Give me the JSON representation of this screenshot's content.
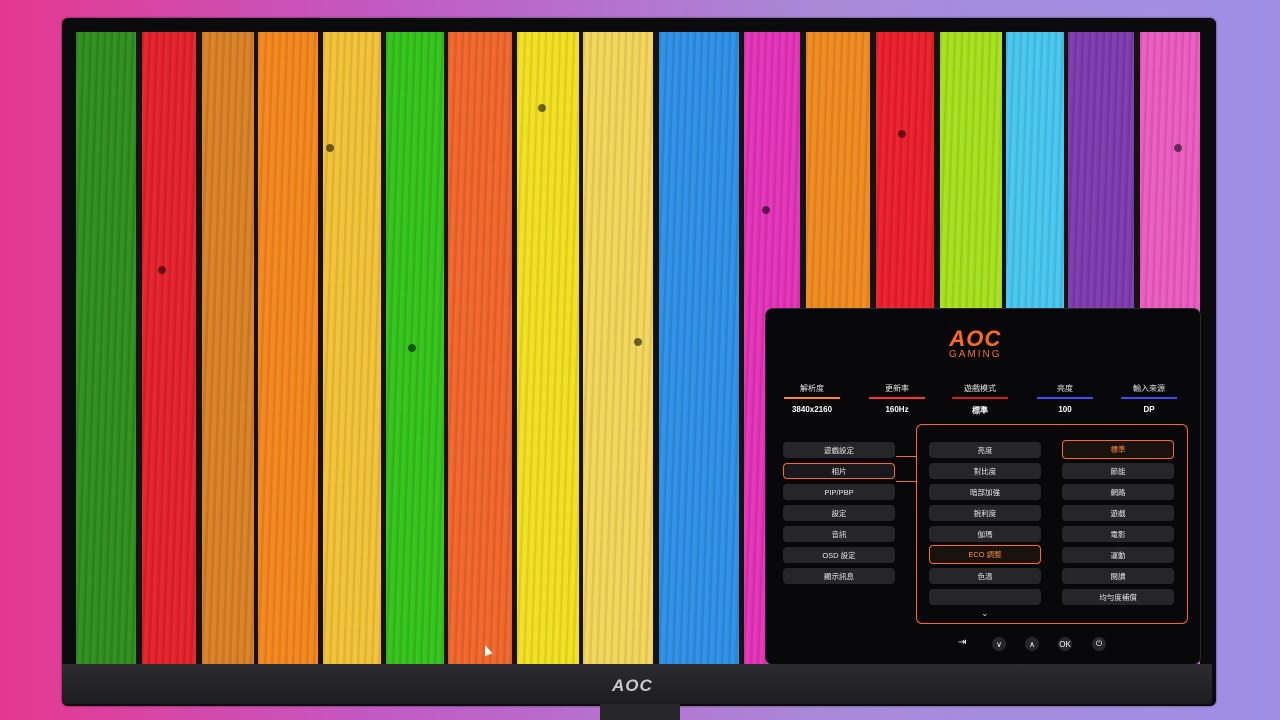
{
  "bezel": {
    "brand": "AOC"
  },
  "osd": {
    "logo": {
      "line1": "AOC",
      "line2": "GAMING"
    },
    "stats": [
      {
        "label": "解析度",
        "value": "3840x2160",
        "color": "#ff8a1a"
      },
      {
        "label": "更新率",
        "value": "160Hz",
        "color": "#ff3030"
      },
      {
        "label": "遊戲模式",
        "value": "標準",
        "color": "#d02020"
      },
      {
        "label": "亮度",
        "value": "100",
        "color": "#3a50ff"
      },
      {
        "label": "輸入來源",
        "value": "DP",
        "color": "#3a50ff"
      }
    ],
    "left_menu": [
      "遊戲設定",
      "相片",
      "PIP/PBP",
      "設定",
      "音訊",
      "OSD 設定",
      "顯示訊息"
    ],
    "middle_menu": [
      "亮度",
      "對比度",
      "暗部加強",
      "銳利度",
      "伽瑪",
      "ECO 調整",
      "色溫",
      ""
    ],
    "right_menu": [
      "標準",
      "節能",
      "網路",
      "遊戲",
      "電影",
      "運動",
      "閱讀",
      "均勻度補償"
    ],
    "nav_icons": [
      "input-icon",
      "down-icon",
      "up-icon",
      "ok-icon",
      "power-icon"
    ],
    "nav_labels": {
      "ok": "OK"
    }
  }
}
